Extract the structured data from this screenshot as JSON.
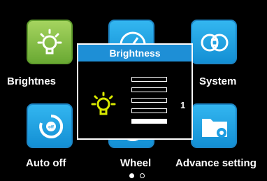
{
  "menu": {
    "items": [
      {
        "label": "Brightnes",
        "icon": "bulb-icon",
        "color": "#7dbd45"
      },
      {
        "label": "",
        "icon": "speedometer-icon",
        "color": "#1e9ee2"
      },
      {
        "label": "System",
        "icon": "system-icon",
        "color": "#1e9ee2"
      },
      {
        "label": "Auto off",
        "icon": "timer-icon",
        "color": "#1e9ee2"
      },
      {
        "label": "Wheel",
        "icon": "wheel-icon",
        "color": "#1e9ee2"
      },
      {
        "label": "Advance setting",
        "icon": "folder-gear-icon",
        "color": "#1e9ee2"
      }
    ]
  },
  "popup": {
    "title": "Brightness",
    "icon": "bulb-icon",
    "level": "1",
    "level_count": 5,
    "accent": "#1e8fd6",
    "icon_color": "#d8e800"
  },
  "pagination": {
    "pages": 2,
    "current": 1
  }
}
